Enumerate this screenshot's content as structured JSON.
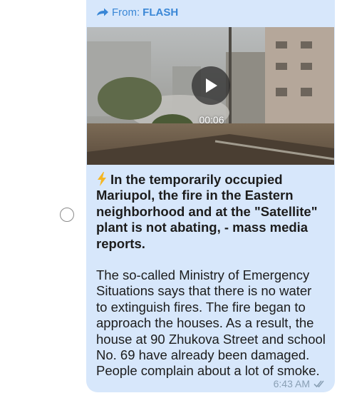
{
  "forward": {
    "prefix": "From:",
    "source": "FLASH",
    "icon": "forward-arrow-icon"
  },
  "video": {
    "duration": "00:06",
    "icon": "play-icon"
  },
  "message": {
    "emoji_icon": "lightning-icon",
    "headline": "In the temporarily occupied\nMariupol, the fire in the Eastern\nneighborhood and at the \"Satellite\"\nplant is not abating, - mass media\nreports.",
    "body": "The so-called Ministry of Emergency\nSituations says that there is no water\nto extinguish fires. The fire began to\napproach the houses. As a result, the\nhouse at 90 Zhukova Street and school\nNo. 69 have already been damaged.\nPeople complain about a lot of smoke."
  },
  "meta": {
    "time": "6:43 AM",
    "status_icon": "double-check-icon"
  },
  "colors": {
    "bubble": "#d7e7fb",
    "accent": "#3a87d6",
    "meta": "#8aa0b5"
  }
}
